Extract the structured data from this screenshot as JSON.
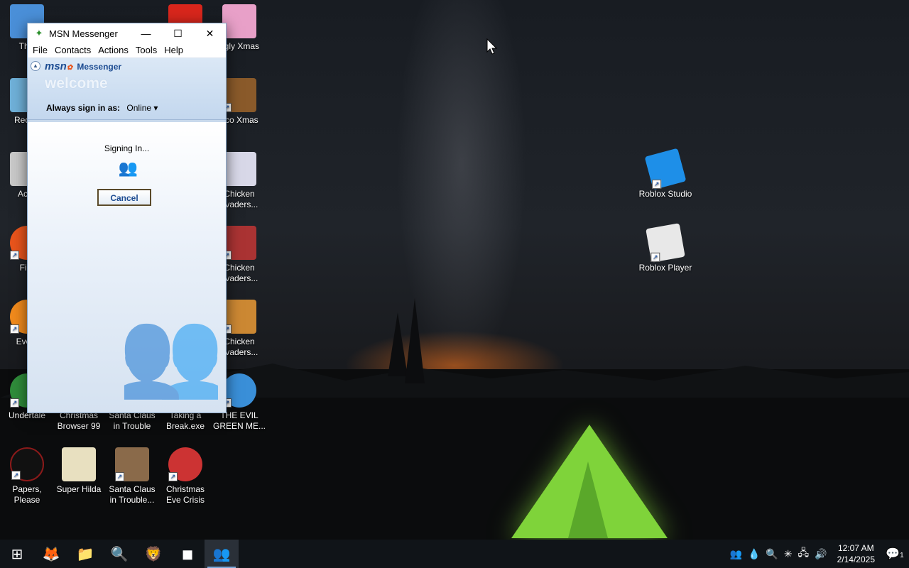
{
  "desktop": {
    "icons": [
      {
        "label": "This",
        "glyph": "🖥",
        "color": "#4a8fd8"
      },
      {
        "label": "Recycl",
        "glyph": "♻",
        "color": "#6fb0d8"
      },
      {
        "label": "Activ",
        "glyph": "▭",
        "color": "#c8c8c8"
      },
      {
        "label": "Fire",
        "glyph": "🔥",
        "color": "#e8541c"
      },
      {
        "label": "Every",
        "glyph": "⚲",
        "color": "#f08a1c"
      },
      {
        "label": "Undertale",
        "glyph": "☺",
        "color": "#2f8c3a"
      },
      {
        "label": "Papers, Please",
        "glyph": "✦",
        "color": "#8b1a1a"
      },
      {
        "label": "Christmas Browser 99",
        "glyph": "🎄",
        "color": "#2a6"
      },
      {
        "label": "Super Hilda",
        "glyph": "▦",
        "color": "#e8e0c0"
      },
      {
        "label": "Santa Claus in Trouble",
        "glyph": "🎅",
        "color": "#b33"
      },
      {
        "label": "Santa Claus in Trouble...",
        "glyph": "🎅",
        "color": "#8a6a4a"
      },
      {
        "label": "Taking a Break.exe",
        "glyph": "☕",
        "color": "#555"
      },
      {
        "label": "Christmas Eve Crisis",
        "glyph": "🎅",
        "color": "#c33"
      },
      {
        "label": "ggly Xmas",
        "glyph": "🐷",
        "color": "#e8a0c8"
      },
      {
        "label": "oco Xmas",
        "glyph": "🧸",
        "color": "#8a5a2a"
      },
      {
        "label": "Chicken nvaders...",
        "glyph": "🐔",
        "color": "#d8d8e8"
      },
      {
        "label": "Chicken nvaders...",
        "glyph": "🐔",
        "color": "#a33"
      },
      {
        "label": "Chicken nvaders...",
        "glyph": "🐔",
        "color": "#c83"
      },
      {
        "label": "THE EVIL GREEN ME...",
        "glyph": "👥",
        "color": "#3a8fd8"
      },
      {
        "label": "Roblox Studio",
        "glyph": "◆",
        "color": "#1e8fe8"
      },
      {
        "label": "Roblox Player",
        "glyph": "■",
        "color": "#e8e8e8"
      }
    ]
  },
  "window": {
    "title": "MSN Messenger",
    "controls": {
      "minimize": "—",
      "maximize": "☐",
      "close": "✕"
    },
    "menu": [
      "File",
      "Contacts",
      "Actions",
      "Tools",
      "Help"
    ],
    "logo": {
      "brand": "msn",
      "product": "Messenger"
    },
    "welcome": "welcome",
    "sign_in_label": "Always sign in as:",
    "sign_in_status": "Online ▾",
    "signing_text": "Signing In...",
    "buddy_glyph": "👥",
    "cancel_label": "Cancel"
  },
  "taskbar": {
    "start_glyph": "⊞",
    "apps": [
      {
        "name": "firefox",
        "glyph": "🦊"
      },
      {
        "name": "file-explorer",
        "glyph": "📁"
      },
      {
        "name": "search-everything",
        "glyph": "🔍"
      },
      {
        "name": "brave",
        "glyph": "🦁"
      },
      {
        "name": "roblox",
        "glyph": "◼"
      },
      {
        "name": "msn-messenger",
        "glyph": "👥"
      }
    ],
    "tray_icons": [
      "👥",
      "💧",
      "🔍",
      "✳",
      "🖧",
      "🔊"
    ],
    "time": "12:07 AM",
    "date": "2/14/2025",
    "notification_badge": "1"
  }
}
